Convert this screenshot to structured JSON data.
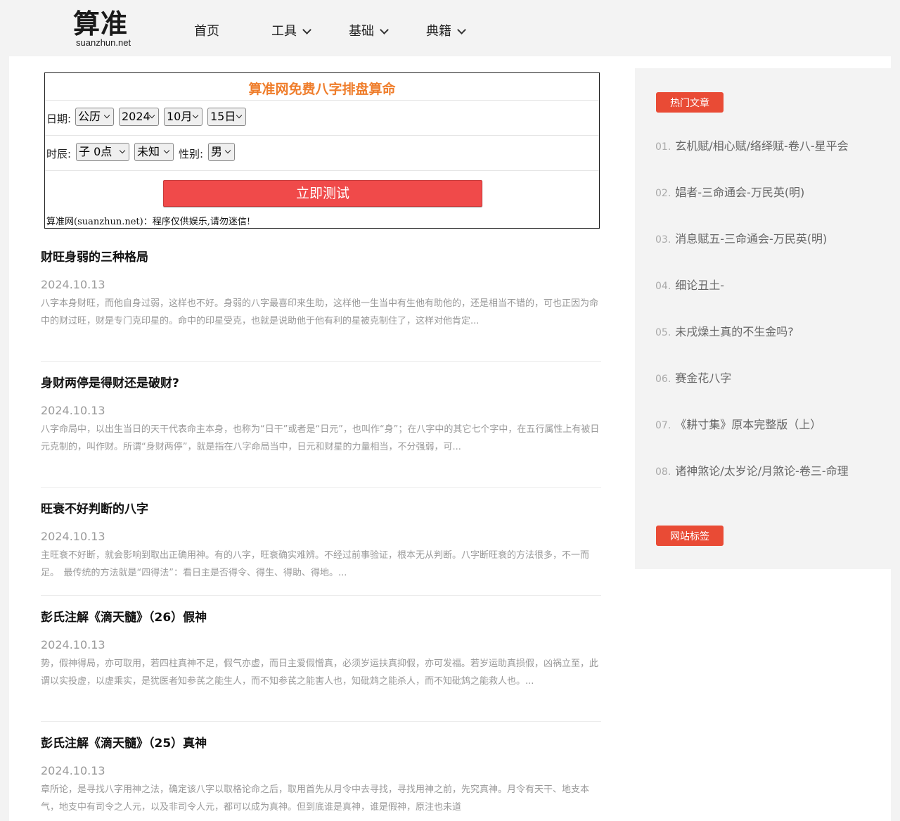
{
  "header": {
    "logo_main": "算准",
    "logo_sub": "suanzhun.net",
    "nav": [
      {
        "label": "首页"
      },
      {
        "label": "工具"
      },
      {
        "label": "基础"
      },
      {
        "label": "典籍"
      }
    ]
  },
  "calculator": {
    "title": "算准网免费八字排盘算命",
    "date_label": "日期:",
    "calendar": "公历",
    "year": "2024",
    "month": "10月",
    "day": "15日",
    "hour_label": "时辰:",
    "hour": "子 0点",
    "minute": "未知",
    "gender_label": "性别:",
    "gender": "男",
    "submit_label": "立即测试",
    "disclaimer": "算准网(suanzhun.net)：程序仅供娱乐,请勿迷信!"
  },
  "articles": [
    {
      "title": "财旺身弱的三种格局",
      "date": "2024.10.13",
      "excerpt": "八字本身财旺，而他自身过弱，这样也不好。身弱的八字最喜印来生助，这样他一生当中有生他有助他的，还是相当不错的，可也正因为命中的财过旺，财是专门克印星的。命中的印星受克，也就是说助他于他有利的星被克制住了，这样对他肯定..."
    },
    {
      "title": "身财两停是得财还是破财?",
      "date": "2024.10.13",
      "excerpt": "八字命局中，以出生当日的天干代表命主本身，也称为“日干”或者是“日元”，也叫作“身”；在八字中的其它七个字中，在五行属性上有被日元克制的，叫作财。所谓“身财两停”，就是指在八字命局当中，日元和财星的力量相当，不分强弱，可..."
    },
    {
      "title": "旺衰不好判断的八字",
      "date": "2024.10.13",
      "excerpt": "主旺衰不好断，就会影响到取出正确用神。有的八字，旺衰确实难辨。不经过前事验证，根本无从判断。八字断旺衰的方法很多，不一而足。　最传统的方法就是“四得法”：看日主是否得令、得生、得助、得地。..."
    },
    {
      "title": "彭氏注解《滴天髓》（26）假神",
      "date": "2024.10.13",
      "excerpt": "势，假神得局，亦可取用，若四柱真神不足，假气亦虚，而日主爱假憎真，必须岁运扶真抑假，亦可发福。若岁运助真损假，凶祸立至，此谓以实投虚，以虚乘实，是犹医者知参芪之能生人，而不知参芪之能害人也，知砒鸩之能杀人，而不知砒鸩之能救人也。..."
    },
    {
      "title": "彭氏注解《滴天髓》（25）真神",
      "date": "2024.10.13",
      "excerpt": "章所论，是寻找八字用神之法，确定该八字以取格论命之后，取用首先从月令中去寻找，寻找用神之前，先究真神。月令有天干、地支本气，地支中有司令之人元，以及非司令人元，都可以成为真神。但到底谁是真神，谁是假神，原注也未道"
    }
  ],
  "sidebar": {
    "hot_title": "热门文章",
    "hot_items": [
      {
        "num": "01.",
        "label": "玄机赋/相心赋/络绎赋-卷八-星平会"
      },
      {
        "num": "02.",
        "label": "娼者-三命通会-万民英(明)"
      },
      {
        "num": "03.",
        "label": "消息赋五-三命通会-万民英(明)"
      },
      {
        "num": "04.",
        "label": "细论丑土-"
      },
      {
        "num": "05.",
        "label": "未戌燥土真的不生金吗?"
      },
      {
        "num": "06.",
        "label": "赛金花八字"
      },
      {
        "num": "07.",
        "label": "《耕寸集》原本完整版（上）"
      },
      {
        "num": "08.",
        "label": "诸神煞论/太岁论/月煞论-卷三-命理"
      }
    ],
    "tags_title": "网站标签"
  }
}
